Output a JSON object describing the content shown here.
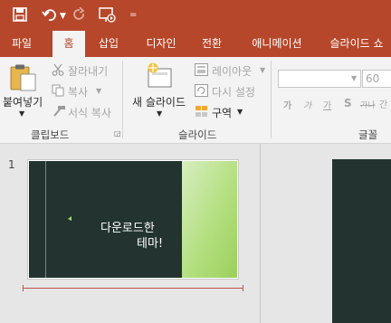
{
  "qat": {
    "icons": [
      "save-icon",
      "undo-icon",
      "undo-dropdown-icon",
      "redo-icon",
      "slideshow-from-start-icon",
      "customize-qat-icon"
    ]
  },
  "tabs": [
    {
      "label": "파일",
      "active": false
    },
    {
      "label": "홈",
      "active": true
    },
    {
      "label": "삽입",
      "active": false
    },
    {
      "label": "디자인",
      "active": false
    },
    {
      "label": "전환",
      "active": false
    },
    {
      "label": "애니메이션",
      "active": false
    },
    {
      "label": "슬라이드 쇼",
      "active": false
    }
  ],
  "clipboard": {
    "paste_label": "붙여넣기",
    "cut_label": "잘라내기",
    "copy_label": "복사",
    "format_painter_label": "서식 복사",
    "group_label": "클립보드"
  },
  "slides_group": {
    "new_slide_label": "새 슬라이드",
    "layout_label": "레이아웃",
    "reset_label": "다시 설정",
    "section_label": "구역",
    "group_label": "슬라이드"
  },
  "font_group": {
    "font_name": "",
    "font_size": "60",
    "format_buttons": [
      "가",
      "가",
      "가",
      "S",
      "가나",
      "간"
    ],
    "group_label": "글꼴"
  },
  "thumbnails": [
    {
      "number": "1",
      "title_line1": "다운로드한",
      "title_line2": "테마!"
    }
  ],
  "colors": {
    "accent": "#b7472a",
    "slide_bg": "#233430",
    "green": "#a9d86e"
  }
}
